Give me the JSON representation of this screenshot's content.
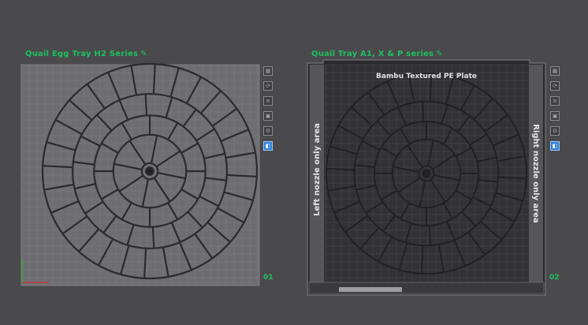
{
  "plates": [
    {
      "title": "Quail Egg Tray H2 Series",
      "number": "01",
      "tools": [
        "arrange-icon",
        "orient-icon",
        "list-icon",
        "lock-icon",
        "settings-icon",
        "layers-icon"
      ]
    },
    {
      "title": "Quail Tray A1, X & P series",
      "number": "02",
      "plate_name": "Bambu Textured PE Plate",
      "left_label": "Left nozzle only area",
      "right_label": "Right nozzle only area",
      "tools": [
        "arrange-icon",
        "orient-icon",
        "list-icon",
        "lock-icon",
        "settings-icon",
        "layers-icon"
      ]
    }
  ],
  "icons": {
    "edit": "edit-icon"
  },
  "colors": {
    "background": "#4a4a4d",
    "title_green": "#20c060",
    "plate_light": "#6e6e72",
    "plate_dark": "#2f2f32",
    "active_tool": "#2f7fd6"
  }
}
